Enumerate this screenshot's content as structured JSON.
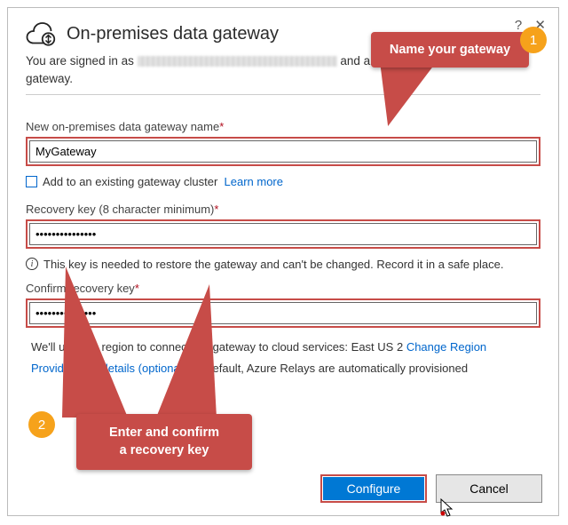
{
  "window": {
    "title": "On-premises data gateway",
    "help_glyph": "?",
    "close_glyph": "✕"
  },
  "signed_in": {
    "prefix": "You are signed in as ",
    "suffix": " and are ready to register the gateway."
  },
  "labels": {
    "gateway_name": "New on-premises data gateway name",
    "recovery_key": "Recovery key (8 character minimum)",
    "confirm_key": "Confirm recovery key",
    "add_cluster": "Add to an existing gateway cluster",
    "learn_more": "Learn more"
  },
  "fields": {
    "gateway_name_value": "MyGateway",
    "recovery_key_value": "•••••••••••••••",
    "confirm_key_value": "•••••••••••••••"
  },
  "hint": "This key is needed to restore the gateway and can't be changed. Record it in a safe place.",
  "region": {
    "line1_pre": "We'll use this region to connect the gateway to cloud services: ",
    "current": "East US 2",
    "change_link": "Change Region",
    "relay_link": "Provide relay details (optional)",
    "line2_post": " By default, Azure Relays are automatically provisioned"
  },
  "buttons": {
    "configure": "Configure",
    "cancel": "Cancel"
  },
  "callouts": {
    "c1_text": "Name your gateway",
    "c1_num": "1",
    "c2_text_a": "Enter and confirm",
    "c2_text_b": "a recovery key",
    "c2_num": "2"
  },
  "required_mark": "*"
}
